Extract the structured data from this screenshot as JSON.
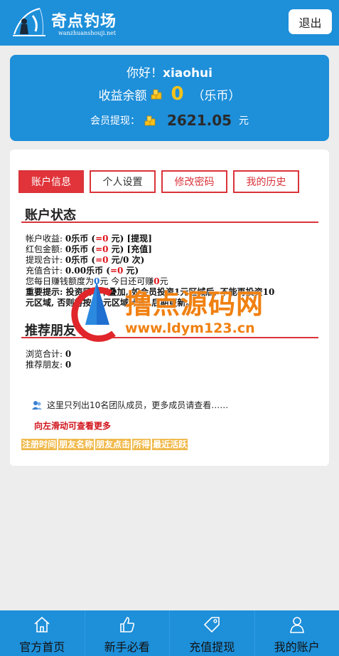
{
  "header": {
    "logo_text": "奇点钓场",
    "logo_sub": "wanzhuanshouji.net",
    "logout": "退出"
  },
  "summary": {
    "greeting": "你好！",
    "username": "xiaohui",
    "balance_label": "收益余额",
    "balance_value": "0",
    "balance_unit": "（乐币）",
    "withdraw_label": "会员提现：",
    "withdraw_value": "2621.05",
    "withdraw_unit": "元"
  },
  "tabs": [
    "账户信息",
    "个人设置",
    "修改密码",
    "我的历史"
  ],
  "account": {
    "title": "账户状态",
    "lines": {
      "l1a": "帐户收益: ",
      "l1b": "0乐币",
      "l1c": " (",
      "l1d": "=0",
      "l1e": " 元) [提现]",
      "l2a": "红包金额: ",
      "l2b": "0乐币",
      "l2c": " (",
      "l2d": "=0",
      "l2e": " 元) [充值]",
      "l3a": "提现合计: ",
      "l3b": "0乐币",
      "l3c": " (",
      "l3d": "=0",
      "l3e": " 元/0 次)",
      "l4a": "充值合计: ",
      "l4b": "0.00乐币",
      "l4c": " (",
      "l4d": "=0",
      "l4e": " 元)",
      "l5a": "您每日赚钱额度为",
      "l5b": "0",
      "l5c": "元 今日还可赚",
      "l5d": "0",
      "l5e": "元",
      "l6": "重要提示: 投资区域不叠加, 如会员投资1元区域后, 不能再投资10",
      "l7": "元区域, 否则将按10元区域计算, 后期更新。"
    }
  },
  "friends": {
    "title": "推荐朋友",
    "views_label": "浏览合计: ",
    "views": "0",
    "recommend_label": "推荐朋友: ",
    "recommend": "0"
  },
  "team": {
    "note": "这里只列出10名团队成员，更多成员请查看……",
    "swipe": "向左滑动可查看更多",
    "headers": [
      "注册时间",
      "朋友名称",
      "朋友点击",
      "所得",
      "最近活跃"
    ]
  },
  "watermark": {
    "title": "撸点源码网",
    "url": "www.ldym123.cn"
  },
  "nav": [
    "官方首页",
    "新手必看",
    "充值提现",
    "我的账户"
  ],
  "colors": {
    "primary": "#1e8fd9",
    "accent_red": "#d9343a",
    "gold": "#f6c21a",
    "table_header": "#f0b94a"
  }
}
